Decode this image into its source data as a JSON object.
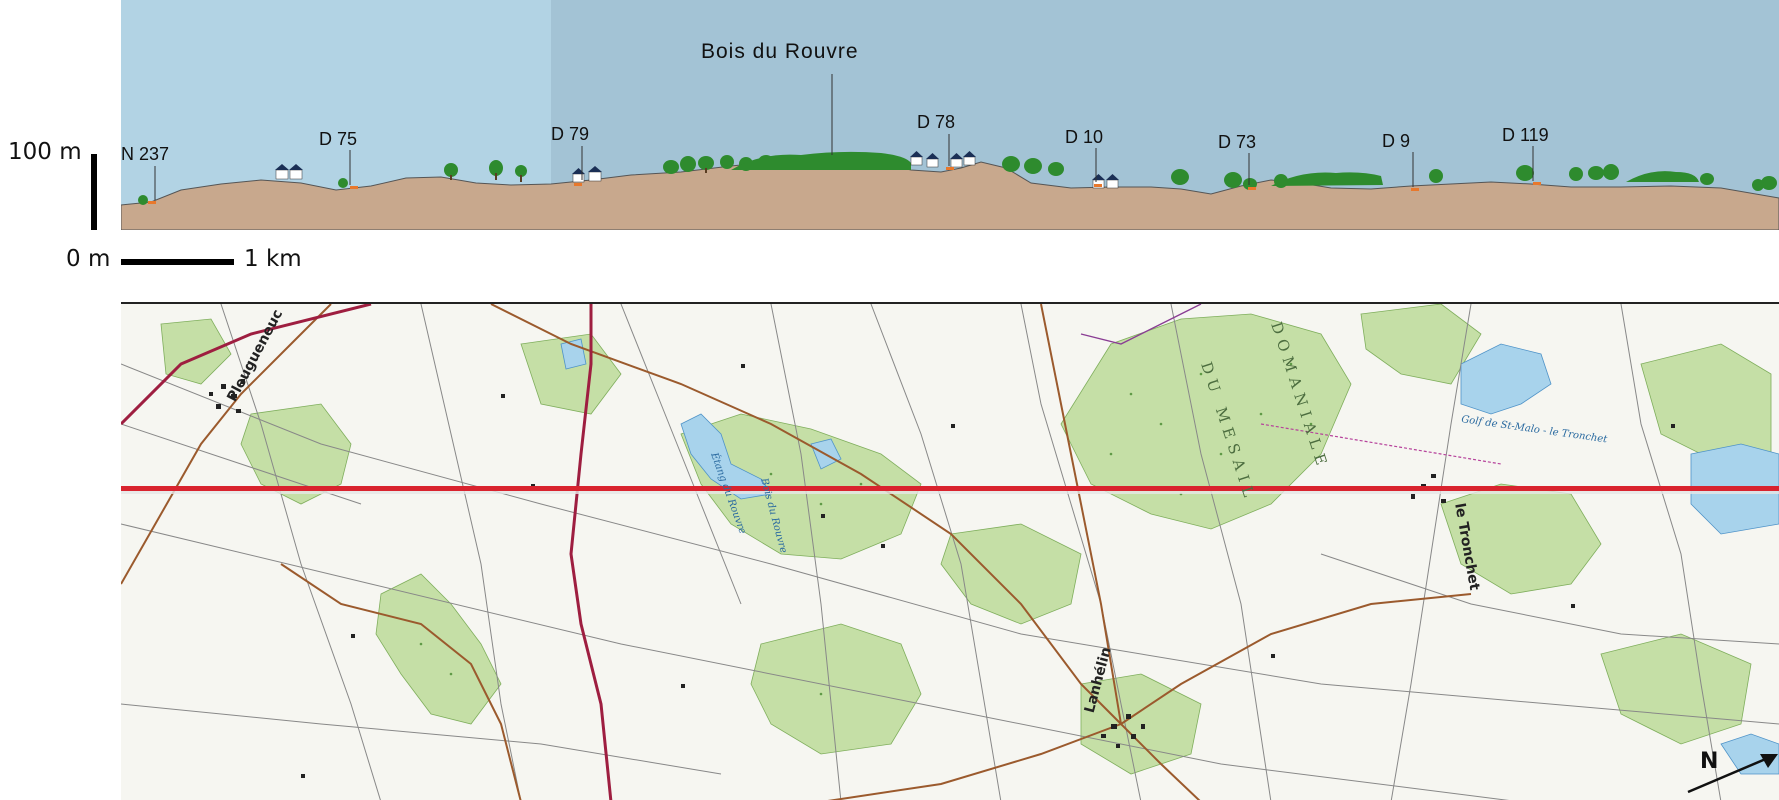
{
  "profile": {
    "summit_label": "Bois du Rouvre",
    "road_labels": [
      {
        "id": "n237",
        "label": "N 237"
      },
      {
        "id": "d75",
        "label": "D 75"
      },
      {
        "id": "d79",
        "label": "D 79"
      },
      {
        "id": "d78",
        "label": "D 78"
      },
      {
        "id": "d10",
        "label": "D 10"
      },
      {
        "id": "d73",
        "label": "D 73"
      },
      {
        "id": "d9",
        "label": "D 9"
      },
      {
        "id": "d119",
        "label": "D 119"
      }
    ],
    "sky_color": "#b2d3e4",
    "sky_forest_color": "#a3c3d5",
    "ground_color": "#c8a88d",
    "tree_color": "#2e8b2e"
  },
  "scale": {
    "vertical_top_label": "100 m",
    "vertical_bottom_label": "0 m",
    "horizontal_label": "1 km"
  },
  "map": {
    "places": {
      "pleugueneuc": "Pleugueneuc",
      "le_tronchet": "le Tronchet",
      "lanhelin": "Lanhélin"
    },
    "forest_words": {
      "domaniale": "DOMANIALE",
      "du_mesail": "DU MESAIL"
    },
    "golf_label": "Golf de St-Malo - le Tronchet",
    "etang_label": "Étang du Rouvre",
    "bois_label": "Bois du Rouvre",
    "transect_color": "#d9232e",
    "forest_color": "#c5dfa6",
    "water_color": "#a8d3ec"
  },
  "north": {
    "label": "N"
  }
}
